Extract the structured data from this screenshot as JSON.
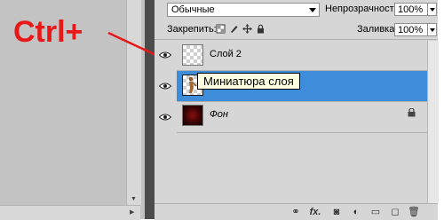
{
  "annotation": {
    "text": "Ctrl+"
  },
  "toolbar": {
    "blend_mode": "Обычные",
    "opacity_label": "Непрозрачность:",
    "opacity_value": "100%",
    "lock_label": "Закрепить:",
    "fill_label": "Заливка:",
    "fill_value": "100%"
  },
  "layers": [
    {
      "name": "Слой 2",
      "thumbnail": "transparent",
      "visible": true,
      "selected": false
    },
    {
      "name": "",
      "thumbnail": "figure",
      "visible": true,
      "selected": true
    },
    {
      "name": "Фон",
      "thumbnail": "dark-red",
      "visible": true,
      "selected": false,
      "locked": true
    }
  ],
  "tooltip": {
    "text": "Миниатюра слоя"
  },
  "bottom_icons": [
    "link-icon",
    "fx-icon",
    "mask-icon",
    "adjustment-icon",
    "folder-icon",
    "new-layer-icon",
    "trash-icon"
  ],
  "colors": {
    "panel_bg": "#d6d6d6",
    "selection": "#3d8ddb",
    "annotation_red": "#e81818",
    "canvas_bg": "#c3c3c3"
  }
}
